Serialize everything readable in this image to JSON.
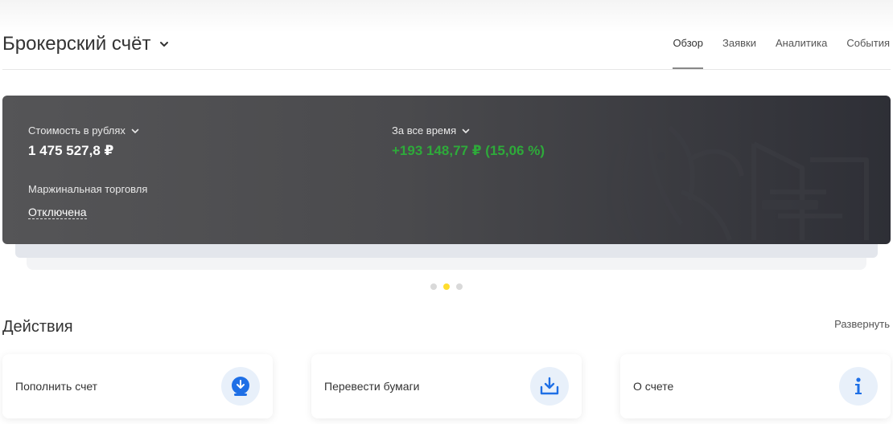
{
  "header": {
    "account_title": "Брокерский счёт",
    "tabs": [
      {
        "label": "Обзор",
        "active": true
      },
      {
        "label": "Заявки",
        "active": false
      },
      {
        "label": "Аналитика",
        "active": false
      },
      {
        "label": "События",
        "active": false
      }
    ]
  },
  "summary_card": {
    "value_label": "Стоимость в рублях",
    "value": "1 475 527,8 ₽",
    "period_label": "За все время",
    "profit": "+193 148,77 ₽ (15,06 %)",
    "margin_label": "Маржинальная торговля",
    "margin_status": "Отключена"
  },
  "carousel": {
    "total": 3,
    "active_index": 1
  },
  "actions": {
    "title": "Действия",
    "expand_label": "Развернуть",
    "items": [
      {
        "label": "Пополнить счет",
        "icon": "deposit-icon"
      },
      {
        "label": "Перевести бумаги",
        "icon": "transfer-securities-icon"
      },
      {
        "label": "О счете",
        "icon": "info-icon"
      }
    ]
  },
  "colors": {
    "profit_green": "#2eaa3a",
    "accent_yellow": "#ffdd2d",
    "icon_blue": "#1e6fe6",
    "icon_bg": "#e8f0fa"
  }
}
